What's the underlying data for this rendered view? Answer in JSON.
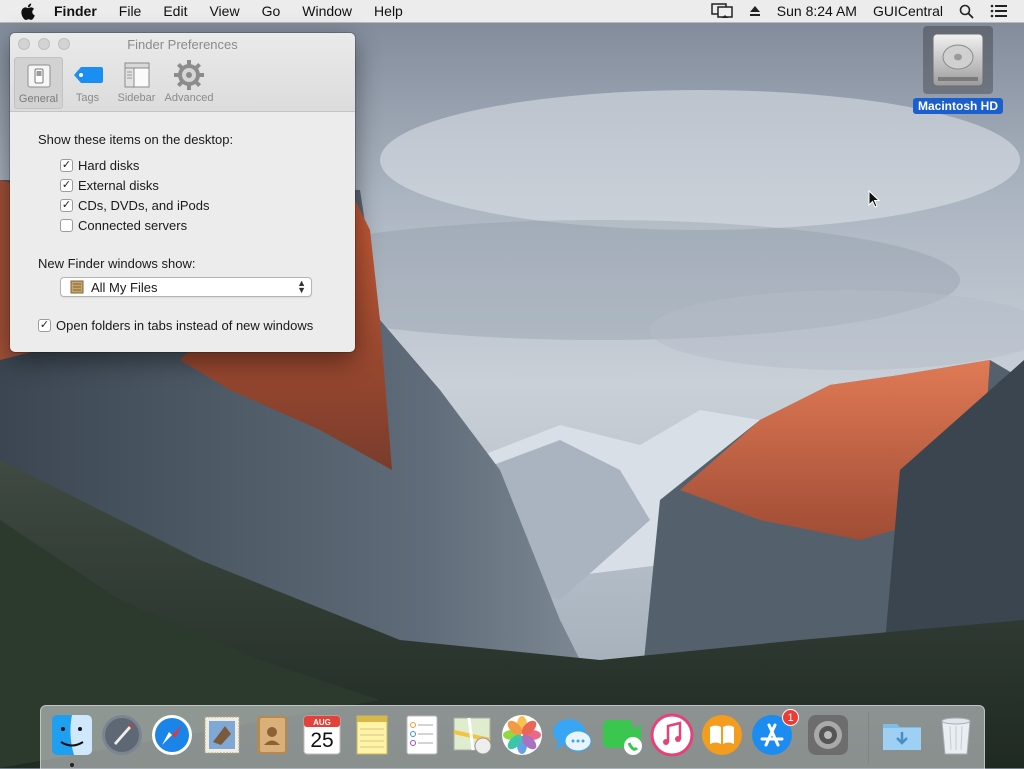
{
  "menubar": {
    "app_name": "Finder",
    "menus": [
      "File",
      "Edit",
      "View",
      "Go",
      "Window",
      "Help"
    ],
    "clock": "Sun 8:24 AM",
    "user": "GUICentral",
    "icons": [
      "apple-icon",
      "display-mirroring-icon",
      "eject-icon",
      "spotlight-icon",
      "notification-center-icon"
    ]
  },
  "desktop": {
    "hd_label": "Macintosh HD"
  },
  "prefs": {
    "title": "Finder Preferences",
    "tabs": [
      {
        "label": "General",
        "icon": "general-switch-icon",
        "selected": true
      },
      {
        "label": "Tags",
        "icon": "tag-icon",
        "selected": false
      },
      {
        "label": "Sidebar",
        "icon": "sidebar-icon",
        "selected": false
      },
      {
        "label": "Advanced",
        "icon": "gear-icon",
        "selected": false
      }
    ],
    "desktop_heading": "Show these items on the desktop:",
    "desktop_items": [
      {
        "label": "Hard disks",
        "checked": true
      },
      {
        "label": "External disks",
        "checked": true
      },
      {
        "label": "CDs, DVDs, and iPods",
        "checked": true
      },
      {
        "label": "Connected servers",
        "checked": false
      }
    ],
    "new_window_heading": "New Finder windows show:",
    "new_window_value": "All My Files",
    "open_tabs_label": "Open folders in tabs instead of new windows",
    "open_tabs_checked": true
  },
  "dock": {
    "apps": [
      {
        "name": "Finder",
        "icon": "finder-icon",
        "running": true
      },
      {
        "name": "Launchpad",
        "icon": "launchpad-rocket-icon"
      },
      {
        "name": "Safari",
        "icon": "safari-compass-icon"
      },
      {
        "name": "Mail",
        "icon": "mail-stamp-icon"
      },
      {
        "name": "Contacts",
        "icon": "contacts-book-icon"
      },
      {
        "name": "Calendar",
        "icon": "calendar-icon",
        "month": "AUG",
        "day": "25"
      },
      {
        "name": "Notes",
        "icon": "notes-icon"
      },
      {
        "name": "Reminders",
        "icon": "reminders-icon"
      },
      {
        "name": "Maps",
        "icon": "maps-icon"
      },
      {
        "name": "Photos",
        "icon": "photos-icon"
      },
      {
        "name": "Messages",
        "icon": "messages-icon"
      },
      {
        "name": "FaceTime",
        "icon": "facetime-icon"
      },
      {
        "name": "iTunes",
        "icon": "itunes-icon"
      },
      {
        "name": "iBooks",
        "icon": "ibooks-icon"
      },
      {
        "name": "App Store",
        "icon": "app-store-icon",
        "badge": "1"
      },
      {
        "name": "System Preferences",
        "icon": "system-preferences-gear-icon"
      },
      {
        "name": "Downloads",
        "icon": "downloads-folder-icon"
      },
      {
        "name": "Trash",
        "icon": "trash-icon"
      }
    ]
  }
}
